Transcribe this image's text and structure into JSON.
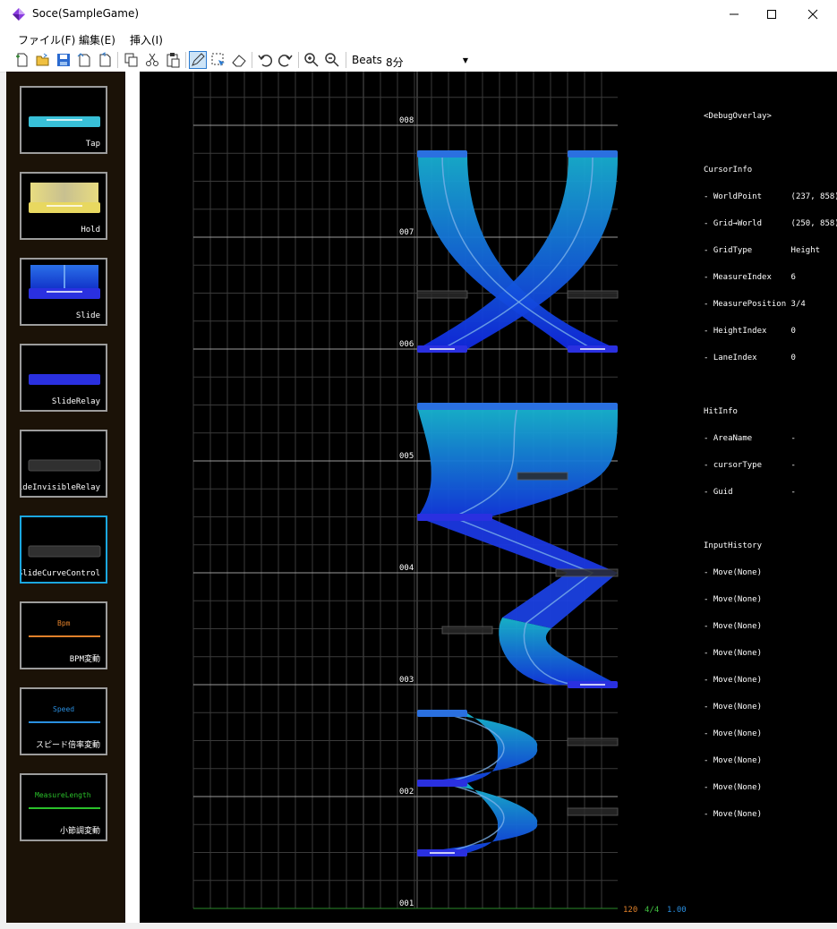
{
  "window": {
    "title": "Soce(SampleGame)"
  },
  "menu": {
    "file": "ファイル(F)",
    "edit": "編集(E)",
    "insert": "挿入(I)"
  },
  "toolbar": {
    "beats_label": "Beats",
    "beats_value": "8分"
  },
  "palette": [
    {
      "label": "Tap"
    },
    {
      "label": "Hold"
    },
    {
      "label": "Slide"
    },
    {
      "label": "SlideRelay"
    },
    {
      "label": "lideInvisibleRelay"
    },
    {
      "label": "SlideCurveControl",
      "selected": true
    },
    {
      "label": "BPM変動",
      "mini": "Bpm",
      "mini_color": "#e0802a"
    },
    {
      "label": "スピード倍率変動",
      "mini": "Speed",
      "mini_color": "#2a8fe0"
    },
    {
      "label": "小節調変動",
      "mini": "MeasureLength",
      "mini_color": "#2ac02a"
    }
  ],
  "measures": [
    "001",
    "002",
    "003",
    "004",
    "005",
    "006",
    "007",
    "008"
  ],
  "debug": {
    "header": "<DebugOverlay>",
    "cursor_title": "CursorInfo",
    "cursor_lines": [
      "- WorldPoint      (237, 858)",
      "- Grid→World      (250, 858)",
      "- GridType        Height",
      "- MeasureIndex    6",
      "- MeasurePosition 3/4",
      "- HeightIndex     0",
      "- LaneIndex       0"
    ],
    "hit_title": "HitInfo",
    "hit_lines": [
      "- AreaName        -",
      "- cursorType      -",
      "- Guid            -"
    ],
    "input_title": "InputHistory",
    "input_lines": [
      "- Move(None)",
      "- Move(None)",
      "- Move(None)",
      "- Move(None)",
      "- Move(None)",
      "- Move(None)",
      "- Move(None)",
      "- Move(None)",
      "- Move(None)",
      "- Move(None)"
    ]
  },
  "status": {
    "bpm": "120",
    "signature": "4/4",
    "speed": "1.00"
  },
  "colors": {
    "bpm": "#e0802a",
    "signature": "#40c040",
    "speed": "#2a8fe0",
    "selected_border": "#1ba7e0"
  }
}
